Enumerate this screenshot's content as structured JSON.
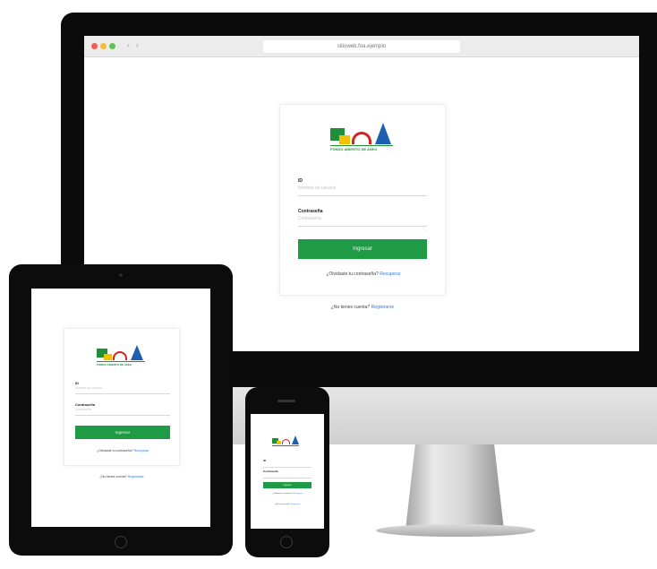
{
  "browser": {
    "url": "sitioweb.foa.ejemplo"
  },
  "logo": {
    "caption": "FONDO ABIERTO DE ASEO"
  },
  "login": {
    "user_label": "ID",
    "user_placeholder": "Nombre de usuario",
    "password_label": "Contraseña",
    "password_placeholder": "Contraseña",
    "submit_label": "Ingresar",
    "forgot_text": "¿Olvidaste tu contraseña?",
    "forgot_link": "Recuperar",
    "register_text": "¿No tienes cuenta?",
    "register_link": "Registrarse"
  },
  "colors": {
    "brand_green": "#1f9a45",
    "logo_red": "#d6221e",
    "logo_blue": "#1d5fb0",
    "logo_yellow": "#f2c200",
    "link_blue": "#2a7de1"
  },
  "icons": [
    "close-dot-icon",
    "minimize-dot-icon",
    "maximize-dot-icon",
    "back-arrow-icon",
    "forward-arrow-icon",
    "home-button-icon"
  ]
}
